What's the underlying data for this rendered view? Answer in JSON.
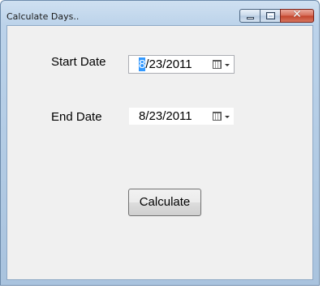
{
  "window": {
    "title": "Calculate Days..",
    "close_glyph": "✕"
  },
  "form": {
    "start_label": "Start Date",
    "start_date_selected": "8",
    "start_date_rest": "/23/2011",
    "end_label": "End Date",
    "end_date": "8/23/2011",
    "calculate_label": "Calculate"
  },
  "icons": {
    "minimize": "minimize-icon",
    "maximize": "maximize-icon",
    "close": "close-icon",
    "calendar": "calendar-icon",
    "dropdown": "chevron-down-icon"
  },
  "colors": {
    "selection": "#3399ff",
    "client_bg": "#f0f0f0",
    "close_button": "#c2432b"
  }
}
